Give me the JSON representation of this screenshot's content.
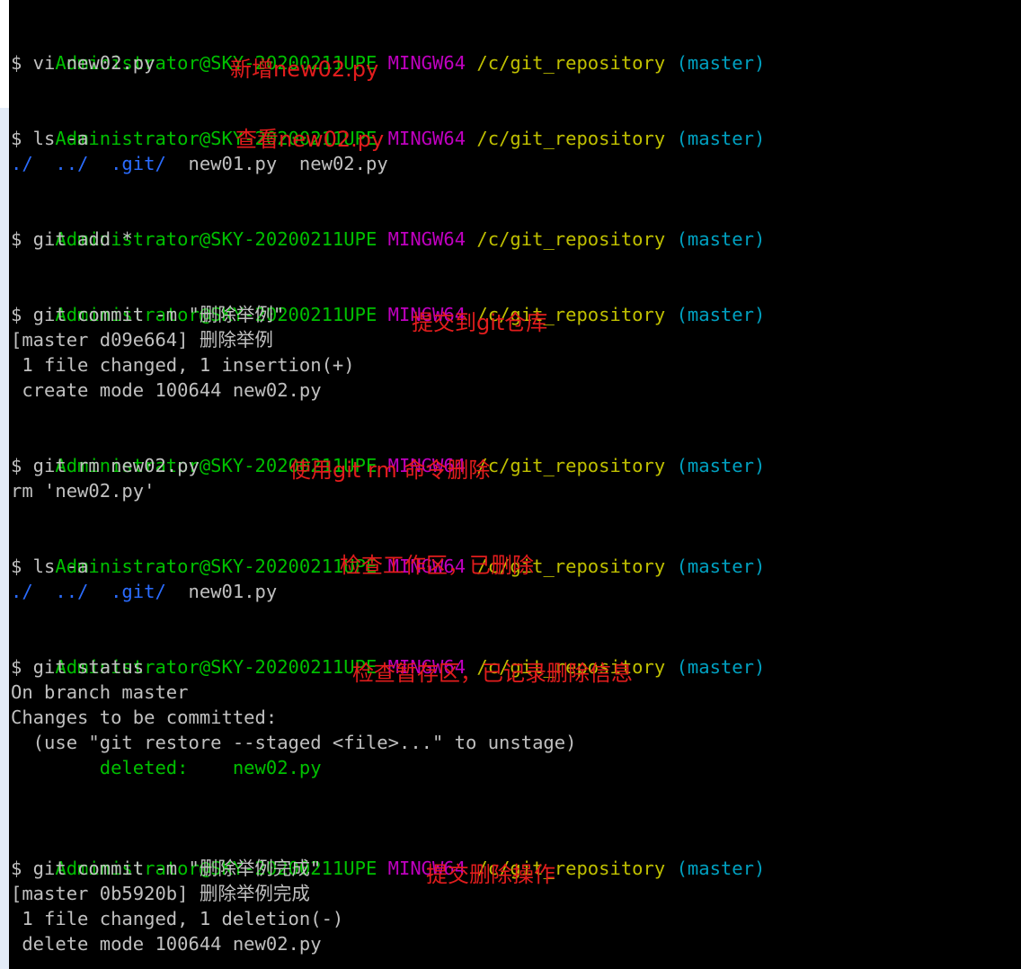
{
  "prompt": {
    "user_host": "Administrator@SKY-20200211UPE",
    "shell": "MINGW64",
    "path": "/c/git_repository",
    "branch": "(master)"
  },
  "blocks": [
    {
      "command": "$ vi new02.py",
      "note": "新增new02.py"
    },
    {
      "command": "$ ls -a",
      "note": "查看new02.py",
      "listing": {
        "dot": "./",
        "dotdot": "../",
        "git": ".git/",
        "files": "new01.py  new02.py"
      }
    },
    {
      "command": "$ git add *"
    },
    {
      "command": "$ git commit -m \"删除举例\"",
      "note": "提交到git仓库",
      "output": [
        "[master d09e664] 删除举例",
        " 1 file changed, 1 insertion(+)",
        " create mode 100644 new02.py"
      ]
    },
    {
      "command": "$ git rm new02.py",
      "note": "使用git rm 命令删除",
      "output": [
        "rm 'new02.py'"
      ]
    },
    {
      "command": "$ ls -a",
      "note": "检查工作区，已删除",
      "listing": {
        "dot": "./",
        "dotdot": "../",
        "git": ".git/",
        "files": "new01.py"
      }
    },
    {
      "command": "$ git status",
      "note": "检查暂存区，已记录删除信息",
      "output": [
        "On branch master",
        "Changes to be committed:",
        "  (use \"git restore --staged <file>...\" to unstage)"
      ],
      "deleted": {
        "label": "        deleted:    ",
        "file": "new02.py"
      }
    },
    {
      "command": "$ git commit -m \"删除举例完成\"",
      "note": "提交删除操作",
      "output": [
        "[master 0b5920b] 删除举例完成",
        " 1 file changed, 1 deletion(-)",
        " delete mode 100644 new02.py"
      ]
    }
  ],
  "colors": {
    "background": "#000000",
    "user_host": "#00c000",
    "shell": "#c000c0",
    "path": "#c0c000",
    "branch": "#00a0c0",
    "directory": "#2a6cff",
    "text": "#c0c0c0",
    "annotation": "#e21d1d"
  }
}
